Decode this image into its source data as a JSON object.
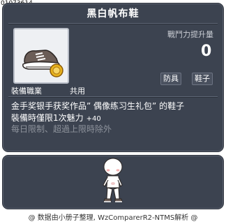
{
  "item_id": "01073614",
  "tooltip": {
    "title": "黑白帆布鞋",
    "stat_label": "戰鬥力提升量",
    "stat_value": "0",
    "chips": [
      "防具",
      "鞋子"
    ],
    "job_label": "裝備職業",
    "job_value": "共用",
    "description_line1": "金手奖银手获奖作品” 偶像练习生礼包” 的鞋子",
    "description_line2": "裝備時僅限1次魅力",
    "description_line2_stat": "+40",
    "description_line3": "每日限制、超過上限時除外"
  },
  "preview": {
    "icon": "character-avatar-icon"
  },
  "footer": "@ 数据由小册子整理, WzComparerR2-NTMS解析 @",
  "colors": {
    "panel_bg": "#3c4350",
    "panel_border": "#2b3039",
    "title_text": "#ffffff",
    "muted_text": "#8e939c",
    "stat_label": "#c9ccd3"
  },
  "icons": {
    "item": "canvas-shoe-icon",
    "badge": "gold-coin-icon"
  }
}
